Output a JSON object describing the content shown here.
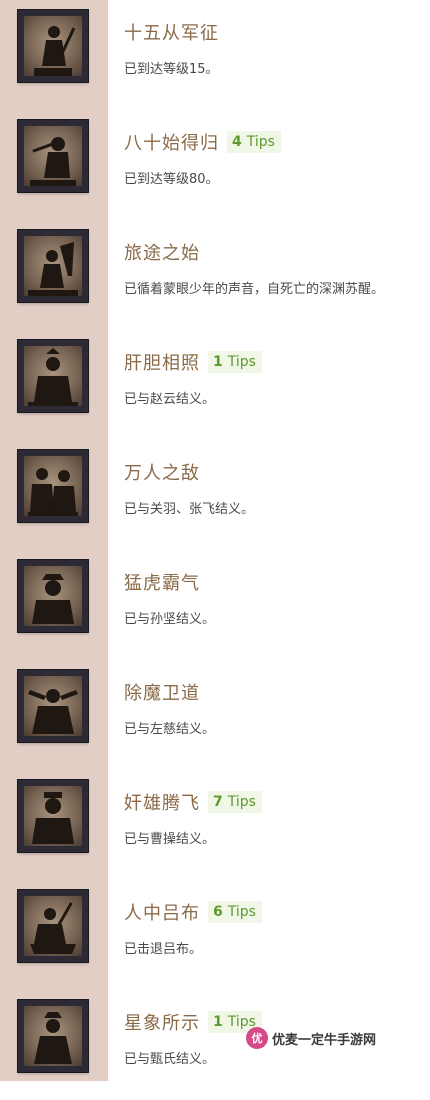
{
  "achievements": [
    {
      "title": "十五从军征",
      "description": "已到达等级15。",
      "tips": null,
      "icon": "warrior-portrait-icon"
    },
    {
      "title": "八十始得归",
      "description": "已到达等级80。",
      "tips": {
        "count": "4",
        "label": "Tips"
      },
      "icon": "veteran-portrait-icon"
    },
    {
      "title": "旅途之始",
      "description": "已循着蒙眼少年的声音，自死亡的深渊苏醒。",
      "tips": null,
      "icon": "journey-portrait-icon"
    },
    {
      "title": "肝胆相照",
      "description": "已与赵云结义。",
      "tips": {
        "count": "1",
        "label": "Tips"
      },
      "icon": "zhao-yun-portrait-icon"
    },
    {
      "title": "万人之敌",
      "description": "已与关羽、张飞结义。",
      "tips": null,
      "icon": "guan-zhang-portrait-icon"
    },
    {
      "title": "猛虎霸气",
      "description": "已与孙坚结义。",
      "tips": null,
      "icon": "sun-jian-portrait-icon"
    },
    {
      "title": "除魔卫道",
      "description": "已与左慈结义。",
      "tips": null,
      "icon": "zuo-ci-portrait-icon"
    },
    {
      "title": "奸雄腾飞",
      "description": "已与曹操结义。",
      "tips": {
        "count": "7",
        "label": "Tips"
      },
      "icon": "cao-cao-portrait-icon"
    },
    {
      "title": "人中吕布",
      "description": "已击退吕布。",
      "tips": {
        "count": "6",
        "label": "Tips"
      },
      "icon": "lu-bu-portrait-icon"
    },
    {
      "title": "星象所示",
      "description": "已与甄氏结义。",
      "tips": {
        "count": "1",
        "label": "Tips"
      },
      "icon": "zhen-shi-portrait-icon"
    }
  ],
  "watermark": {
    "text": "优麦一定牛手游网",
    "logo_text": "优"
  },
  "colors": {
    "band": "#e3cec6",
    "title": "#8a6a48",
    "tips_text": "#5d9a2e",
    "tips_bg": "#f1f7e6",
    "frame": "#2d2a35"
  }
}
